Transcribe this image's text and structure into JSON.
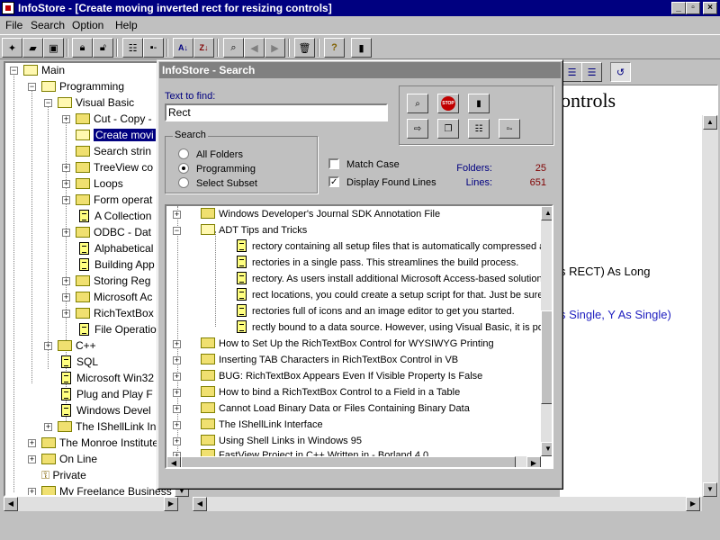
{
  "window": {
    "title": "InfoStore - [Create moving inverted rect for resizing controls]"
  },
  "menu": [
    "File",
    "Search",
    "Option",
    "Help"
  ],
  "tree": {
    "items": [
      {
        "label": "Main",
        "icon": "folder-open-icon"
      },
      {
        "label": "Programming",
        "icon": "folder-open-icon"
      },
      {
        "label": "Visual Basic",
        "icon": "folder-open-icon"
      },
      {
        "label": "Cut - Copy -",
        "icon": "folder-icon"
      },
      {
        "label": "Create movi",
        "icon": "folder-open-icon",
        "selected": true
      },
      {
        "label": "Search strin",
        "icon": "folder-icon"
      },
      {
        "label": "TreeView co",
        "icon": "folder-icon"
      },
      {
        "label": "Loops",
        "icon": "folder-icon"
      },
      {
        "label": "Form operat",
        "icon": "folder-icon"
      },
      {
        "label": "A Collection",
        "icon": "document-icon"
      },
      {
        "label": "ODBC - Dat",
        "icon": "folder-icon"
      },
      {
        "label": "Alphabetical",
        "icon": "document-icon"
      },
      {
        "label": "Building App",
        "icon": "document-icon"
      },
      {
        "label": "Storing Reg",
        "icon": "folder-icon"
      },
      {
        "label": "Microsoft Ac",
        "icon": "folder-icon"
      },
      {
        "label": "RichTextBox",
        "icon": "folder-icon"
      },
      {
        "label": "File Operatio",
        "icon": "document-icon"
      },
      {
        "label": "C++",
        "icon": "folder-icon"
      },
      {
        "label": "SQL",
        "icon": "document-icon"
      },
      {
        "label": "Microsoft Win32",
        "icon": "document-icon"
      },
      {
        "label": "Plug and Play F",
        "icon": "document-icon"
      },
      {
        "label": "Windows Devel",
        "icon": "document-icon"
      },
      {
        "label": "The IShellLink In",
        "icon": "folder-icon"
      },
      {
        "label": "The Monroe Institute",
        "icon": "folder-icon"
      },
      {
        "label": "On Line",
        "icon": "folder-icon"
      },
      {
        "label": "Private",
        "icon": "private-icon"
      },
      {
        "label": "My Freelance Business",
        "icon": "folder-icon"
      }
    ]
  },
  "document": {
    "title_partial": "ontrols",
    "line1": "s RECT) As Long",
    "line2": "s Single, Y As Single)"
  },
  "dialog": {
    "title": "InfoStore - Search",
    "text_to_find_label": "Text to find:",
    "text_to_find_value": "Rect",
    "search_group_label": "Search",
    "radio_all": "All Folders",
    "radio_programming": "Programming",
    "radio_subset": "Select Subset",
    "selected_radio": "Programming",
    "match_case_label": "Match Case",
    "match_case_checked": false,
    "display_found_label": "Display Found Lines",
    "display_found_checked": true,
    "folders_label": "Folders:",
    "folders_value": "25",
    "lines_label": "Lines:",
    "lines_value": "651",
    "stop_text": "STOP",
    "results": [
      {
        "text": "Windows Developer's Journal SDK Annotation File",
        "type": "folder",
        "expander": "+"
      },
      {
        "text": "ADT Tips and Tricks",
        "type": "folder",
        "expander": "-"
      },
      {
        "text": "rectory containing all setup files that is automatically compressed as",
        "type": "line"
      },
      {
        "text": "rectories in a single pass. This streamlines the build process.",
        "type": "line"
      },
      {
        "text": "rectory. As users install additional Microsoft Access-based solutions,",
        "type": "line"
      },
      {
        "text": "rect locations, you could create a setup script for that. Just be sure",
        "type": "line"
      },
      {
        "text": "rectories full of icons and an image editor to get you started.",
        "type": "line"
      },
      {
        "text": "rectly bound to a data source. However, using Visual Basic, it is pos",
        "type": "line"
      },
      {
        "text": "How to Set Up the RichTextBox Control for WYSIWYG Printing",
        "type": "folder",
        "expander": "+"
      },
      {
        "text": "Inserting TAB Characters in RichTextBox Control in VB",
        "type": "folder",
        "expander": "+"
      },
      {
        "text": "BUG: RichTextBox Appears Even If Visible Property Is False",
        "type": "folder",
        "expander": "+"
      },
      {
        "text": "How to bind a RichTextBox Control to a Field in a Table",
        "type": "folder",
        "expander": "+"
      },
      {
        "text": "Cannot Load Binary Data or Files Containing Binary Data",
        "type": "folder",
        "expander": "+"
      },
      {
        "text": "The IShellLink Interface",
        "type": "folder",
        "expander": "+"
      },
      {
        "text": "Using Shell Links in Windows 95",
        "type": "folder",
        "expander": "+"
      },
      {
        "text": "FastView Project in C++ Written in - Borland 4.0",
        "type": "folder",
        "expander": "+"
      }
    ]
  }
}
